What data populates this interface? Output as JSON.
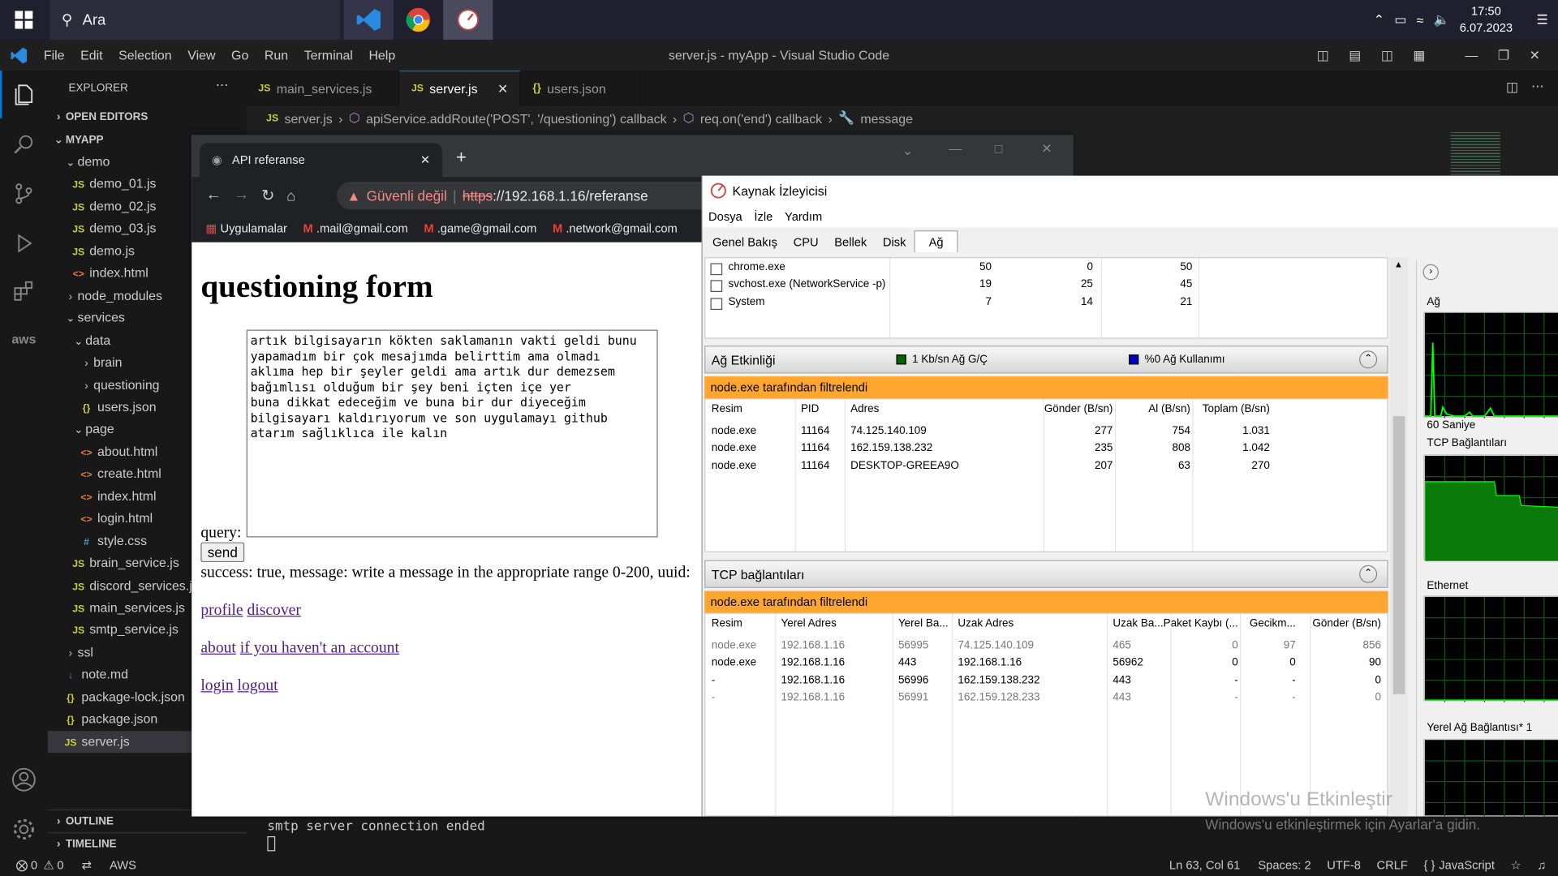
{
  "taskbar": {
    "search_placeholder": "Ara",
    "time": "17:50",
    "date": "6.07.2023"
  },
  "vscode": {
    "menu": [
      "File",
      "Edit",
      "Selection",
      "View",
      "Go",
      "Run",
      "Terminal",
      "Help"
    ],
    "title": "server.js - myApp - Visual Studio Code",
    "explorer_title": "EXPLORER",
    "open_editors": "OPEN EDITORS",
    "project": "MYAPP",
    "tree": [
      {
        "label": "demo",
        "type": "folder",
        "depth": 1,
        "open": true
      },
      {
        "label": "demo_01.js",
        "type": "js",
        "depth": 2
      },
      {
        "label": "demo_02.js",
        "type": "js",
        "depth": 2
      },
      {
        "label": "demo_03.js",
        "type": "js",
        "depth": 2
      },
      {
        "label": "demo.js",
        "type": "js",
        "depth": 2
      },
      {
        "label": "index.html",
        "type": "html",
        "depth": 2
      },
      {
        "label": "node_modules",
        "type": "folder",
        "depth": 1,
        "open": false
      },
      {
        "label": "services",
        "type": "folder",
        "depth": 1,
        "open": true
      },
      {
        "label": "data",
        "type": "folder",
        "depth": 2,
        "open": true
      },
      {
        "label": "brain",
        "type": "folder",
        "depth": 3,
        "open": false
      },
      {
        "label": "questioning",
        "type": "folder",
        "depth": 3,
        "open": false
      },
      {
        "label": "users.json",
        "type": "json",
        "depth": 3
      },
      {
        "label": "page",
        "type": "folder",
        "depth": 2,
        "open": true
      },
      {
        "label": "about.html",
        "type": "html",
        "depth": 3
      },
      {
        "label": "create.html",
        "type": "html",
        "depth": 3
      },
      {
        "label": "index.html",
        "type": "html",
        "depth": 3
      },
      {
        "label": "login.html",
        "type": "html",
        "depth": 3
      },
      {
        "label": "style.css",
        "type": "css",
        "depth": 3
      },
      {
        "label": "brain_service.js",
        "type": "js",
        "depth": 2
      },
      {
        "label": "discord_services.js",
        "type": "js",
        "depth": 2
      },
      {
        "label": "main_services.js",
        "type": "js",
        "depth": 2
      },
      {
        "label": "smtp_service.js",
        "type": "js",
        "depth": 2
      },
      {
        "label": "ssl",
        "type": "folder",
        "depth": 1,
        "open": false
      },
      {
        "label": "note.md",
        "type": "md",
        "depth": 1
      },
      {
        "label": "package-lock.json",
        "type": "json",
        "depth": 1
      },
      {
        "label": "package.json",
        "type": "json",
        "depth": 1
      },
      {
        "label": "server.js",
        "type": "js",
        "depth": 1,
        "selected": true
      }
    ],
    "outline": "OUTLINE",
    "timeline": "TIMELINE",
    "tabs": [
      {
        "label": "main_services.js",
        "icon": "JS"
      },
      {
        "label": "server.js",
        "icon": "JS",
        "active": true
      },
      {
        "label": "users.json",
        "icon": "{}"
      }
    ],
    "breadcrumb": [
      "server.js",
      "apiService.addRoute('POST', '/questioning') callback",
      "req.on('end') callback",
      "message"
    ],
    "terminal_line": "smtp server connection ended",
    "status": {
      "errors": "0",
      "warnings": "0",
      "aws": "AWS",
      "position": "Ln 63, Col 61",
      "spaces": "Spaces: 2",
      "encoding": "UTF-8",
      "eol": "CRLF",
      "language": "JavaScript"
    }
  },
  "browser": {
    "tab_title": "API referanse",
    "security": "Güvenli değil",
    "url_scheme": "https",
    "url_rest": "://192.168.1.16/referanse",
    "bookmarks": [
      "Uygulamalar",
      ".mail@gmail.com",
      ".game@gmail.com",
      ".network@gmail.com"
    ],
    "page": {
      "heading": "questioning form",
      "textarea": "artık bilgisayarın kökten saklamanın vakti geldi bunu\nyapamadım bir çok mesajımda belirttim ama olmadı\naklıma hep bir şeyler geldi ama artık dur demezsem\nbağımlısı olduğum bir şey beni içten içe yer\nbuna dikkat edeceğim ve buna bir dur diyeceğim\nbilgisayarı kaldırıyorum ve son uygulamayı github\natarım sağlıklıca ile kalın",
      "query_label": "query:",
      "send": "send",
      "result": "success: true, message: write a message in the appropriate range 0-200, uuid:",
      "links1": [
        "profile",
        "discover"
      ],
      "links2": [
        "about",
        "if you haven't an account"
      ],
      "links3": [
        "login",
        "logout"
      ]
    }
  },
  "resmon": {
    "title": "Kaynak İzleyicisi",
    "menu": [
      "Dosya",
      "İzle",
      "Yardım"
    ],
    "tabs": [
      "Genel Bakış",
      "CPU",
      "Bellek",
      "Disk",
      "Ağ"
    ],
    "processes": [
      [
        "chrome.exe",
        "50",
        "0",
        "50"
      ],
      [
        "svchost.exe (NetworkService -p)",
        "19",
        "25",
        "45"
      ],
      [
        "System",
        "7",
        "14",
        "21"
      ]
    ],
    "net_activity": {
      "title": "Ağ Etkinliği",
      "legend1": "1 Kb/sn Ağ G/Ç",
      "legend2": "%0 Ağ Kullanımı",
      "filter": "node.exe tarafından filtrelendi",
      "headers": [
        "Resim",
        "PID",
        "Adres",
        "Gönder (B/sn)",
        "Al (B/sn)",
        "Toplam (B/sn)"
      ],
      "rows": [
        [
          "node.exe",
          "11164",
          "74.125.140.109",
          "277",
          "754",
          "1.031"
        ],
        [
          "node.exe",
          "11164",
          "162.159.138.232",
          "235",
          "808",
          "1.042"
        ],
        [
          "node.exe",
          "11164",
          "DESKTOP-GREEA9O",
          "207",
          "63",
          "270"
        ]
      ]
    },
    "tcp": {
      "title": "TCP bağlantıları",
      "filter": "node.exe tarafından filtrelendi",
      "headers": [
        "Resim",
        "Yerel Adres",
        "Yerel Ba...",
        "Uzak Adres",
        "Uzak Ba...",
        "Paket Kaybı (...",
        "Gecikm...",
        "Gönder (B/sn)"
      ],
      "rows": [
        [
          "node.exe",
          "192.168.1.16",
          "56995",
          "74.125.140.109",
          "465",
          "0",
          "97",
          "856"
        ],
        [
          "node.exe",
          "192.168.1.16",
          "443",
          "192.168.1.16",
          "56962",
          "0",
          "0",
          "90"
        ],
        [
          "-",
          "192.168.1.16",
          "56996",
          "162.159.138.232",
          "443",
          "-",
          "-",
          "0"
        ],
        [
          "-",
          "192.168.1.16",
          "56991",
          "162.159.128.233",
          "443",
          "-",
          "-",
          "0"
        ]
      ]
    },
    "graphs": {
      "net": "Ağ",
      "sixty": "60 Saniye",
      "tcp": "TCP Bağlantıları",
      "eth": "Ethernet",
      "local": "Yerel Ağ Bağlantısı* 1"
    }
  },
  "watermark": {
    "line1": "Windows'u Etkinleştir",
    "line2": "Windows'u etkinleştirmek için Ayarlar'a gidin."
  }
}
